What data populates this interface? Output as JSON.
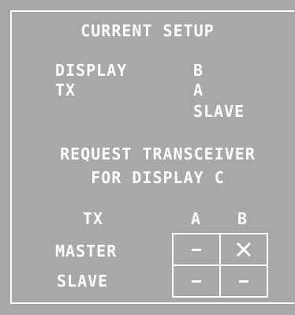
{
  "title": "CURRENT SETUP",
  "setup": {
    "display_label": "DISPLAY",
    "display_value": "B",
    "tx_label": "TX",
    "tx_value": "A",
    "tx_mode": "SLAVE"
  },
  "request": {
    "line1": "REQUEST TRANSCEIVER",
    "line2": "FOR DISPLAY C"
  },
  "grid": {
    "header_label": "TX",
    "col_a": "A",
    "col_b": "B",
    "row_master": "MASTER",
    "row_slave": "SLAVE",
    "cells": {
      "master_a": "dash",
      "master_b": "x-mark",
      "slave_a": "dash",
      "slave_b": "dash"
    }
  },
  "colors": {
    "background": "#a8a8a8",
    "foreground": "#ffffff"
  }
}
